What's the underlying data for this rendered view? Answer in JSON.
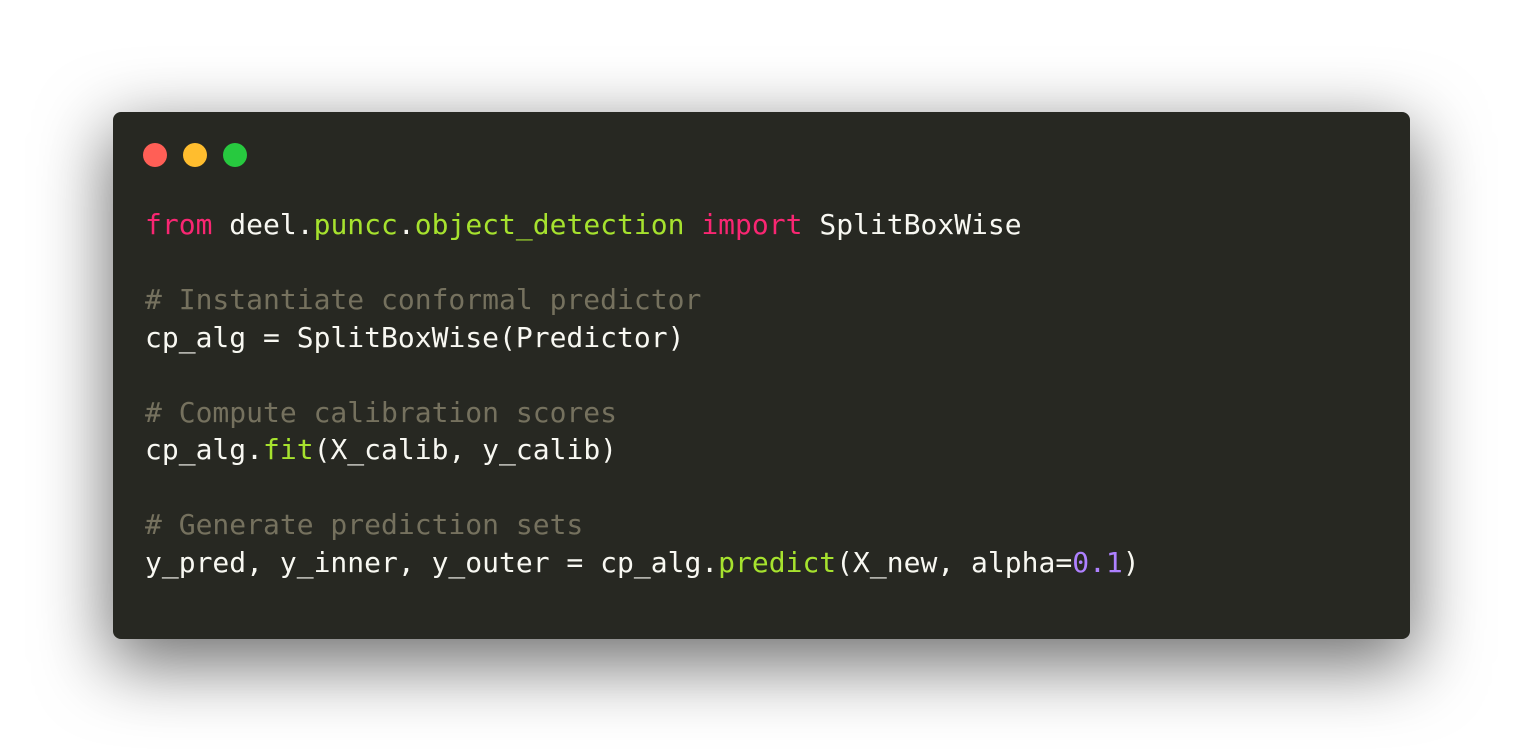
{
  "window": {
    "controls": [
      {
        "name": "close",
        "color": "#ff5f56"
      },
      {
        "name": "minimize",
        "color": "#ffbd2e"
      },
      {
        "name": "zoom",
        "color": "#27c93f"
      }
    ],
    "background": "#272822"
  },
  "colors": {
    "keyword": "#f92672",
    "plain": "#f8f8f2",
    "module": "#a6e22e",
    "function": "#a6e22e",
    "comment": "#75715e",
    "number": "#ae81ff"
  },
  "code": {
    "lines": [
      [
        {
          "t": "keyword",
          "v": "from"
        },
        {
          "t": "plain",
          "v": " deel."
        },
        {
          "t": "module",
          "v": "puncc"
        },
        {
          "t": "plain",
          "v": "."
        },
        {
          "t": "module",
          "v": "object_detection"
        },
        {
          "t": "plain",
          "v": " "
        },
        {
          "t": "keyword",
          "v": "import"
        },
        {
          "t": "plain",
          "v": " SplitBoxWise"
        }
      ],
      [],
      [
        {
          "t": "comment",
          "v": "# Instantiate conformal predictor"
        }
      ],
      [
        {
          "t": "plain",
          "v": "cp_alg = SplitBoxWise(Predictor)"
        }
      ],
      [],
      [
        {
          "t": "comment",
          "v": "# Compute calibration scores"
        }
      ],
      [
        {
          "t": "plain",
          "v": "cp_alg."
        },
        {
          "t": "function",
          "v": "fit"
        },
        {
          "t": "plain",
          "v": "(X_calib, y_calib)"
        }
      ],
      [],
      [
        {
          "t": "comment",
          "v": "# Generate prediction sets"
        }
      ],
      [
        {
          "t": "plain",
          "v": "y_pred, y_inner, y_outer = cp_alg."
        },
        {
          "t": "function",
          "v": "predict"
        },
        {
          "t": "plain",
          "v": "(X_new, alpha="
        },
        {
          "t": "number",
          "v": "0.1"
        },
        {
          "t": "plain",
          "v": ")"
        }
      ]
    ]
  }
}
